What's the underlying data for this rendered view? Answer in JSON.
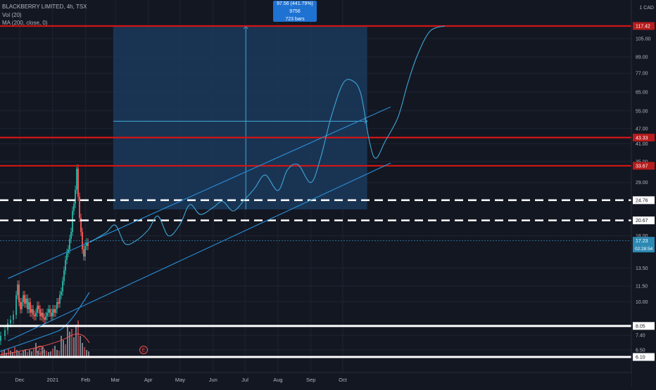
{
  "legend": {
    "symbol": "BLACKBERRY LIMITED, 4h, TSX",
    "volume": "Vol (20)",
    "ma": "MA (200, close, 0)"
  },
  "measure": {
    "line1": "97.56 (441.79%) 9756",
    "line2": "723 bars"
  },
  "currency": "1 CAD",
  "colors": {
    "background": "#131722",
    "price_line": "#3fa7d6",
    "trendline": "#2a8fd8",
    "resistance": "#d11515",
    "support": "#ffffff",
    "measure_fill": "#1b3a5c",
    "label_blue": "#2c89b4"
  },
  "chart_data": {
    "type": "line",
    "title": "BLACKBERRY LIMITED, 4h, TSX",
    "y_scale": "log",
    "ylim": [
      6.1,
      150.0
    ],
    "xlabel": "",
    "ylabel": "",
    "x_tick_labels": [
      "Dec",
      "2021",
      "Feb",
      "Mar",
      "Apr",
      "May",
      "Jun",
      "Jul",
      "Aug",
      "Sep",
      "Oct"
    ],
    "x_ticks": [
      "2020-12-01",
      "2021-01-01",
      "2021-02-01",
      "2021-03-01",
      "2021-04-01",
      "2021-05-01",
      "2021-06-01",
      "2021-07-01",
      "2021-08-01",
      "2021-09-01",
      "2021-10-01"
    ],
    "y_tick_labels": [
      "105.00",
      "89.00",
      "77.00",
      "65.00",
      "55.00",
      "47.00",
      "41.00",
      "35.00",
      "29.00",
      "18.00",
      "13.50",
      "11.50",
      "10.00",
      "7.40",
      "6.50"
    ],
    "y_ticks": [
      105,
      89,
      77,
      65,
      55,
      47,
      41,
      35,
      29,
      18,
      13.5,
      11.5,
      10.0,
      7.4,
      6.5
    ],
    "horizontal_levels": [
      {
        "value": 117.42,
        "label": "117.42",
        "style": "resistance"
      },
      {
        "value": 43.33,
        "label": "43.33",
        "style": "resistance"
      },
      {
        "value": 33.67,
        "label": "33.67",
        "style": "resistance"
      },
      {
        "value": 24.76,
        "label": "24.76",
        "style": "dashed"
      },
      {
        "value": 20.67,
        "label": "20.67",
        "style": "dashed"
      },
      {
        "value": 8.05,
        "label": "8.05",
        "style": "support"
      },
      {
        "value": 6.1,
        "label": "6.10",
        "style": "support"
      }
    ],
    "current_price": {
      "value": 17.23,
      "label": "17.23",
      "countdown": "02:28:54"
    },
    "trendlines": [
      {
        "x": [
          "2020-11-20",
          "2021-11-15"
        ],
        "y": [
          12.3,
          57.0
        ]
      },
      {
        "x": [
          "2020-11-20",
          "2021-11-15"
        ],
        "y": [
          7.05,
          34.5
        ]
      }
    ],
    "measure_range": {
      "x": [
        "2021-03-01",
        "2021-10-20"
      ],
      "y": [
        22.8,
        117.42
      ]
    },
    "series": [
      {
        "x": [
          "2021-02-05",
          "2021-02-20",
          "2021-03-01",
          "2021-03-10",
          "2021-03-20",
          "2021-04-01",
          "2021-04-10",
          "2021-04-20",
          "2021-05-01",
          "2021-05-10",
          "2021-05-20",
          "2021-06-01",
          "2021-06-10",
          "2021-06-20",
          "2021-07-01",
          "2021-07-10",
          "2021-07-20",
          "2021-08-01",
          "2021-08-10",
          "2021-08-20",
          "2021-09-01",
          "2021-09-10",
          "2021-09-20",
          "2021-10-01",
          "2021-10-10",
          "2021-10-18",
          "2021-10-26",
          "2021-11-01",
          "2021-11-10",
          "2021-11-22",
          "2021-12-01",
          "2021-12-10",
          "2021-12-22",
          "2022-01-05"
        ],
        "values": [
          17.0,
          18.5,
          19.8,
          16.8,
          17.2,
          19.0,
          21.5,
          18.0,
          20.0,
          23.8,
          21.8,
          23.2,
          24.5,
          22.5,
          25.0,
          27.5,
          31.0,
          27.0,
          32.5,
          34.0,
          29.0,
          36.0,
          52.0,
          70.0,
          72.0,
          64.0,
          42.0,
          36.0,
          42.0,
          52.0,
          70.0,
          90.0,
          112.0,
          117.42
        ]
      }
    ]
  }
}
